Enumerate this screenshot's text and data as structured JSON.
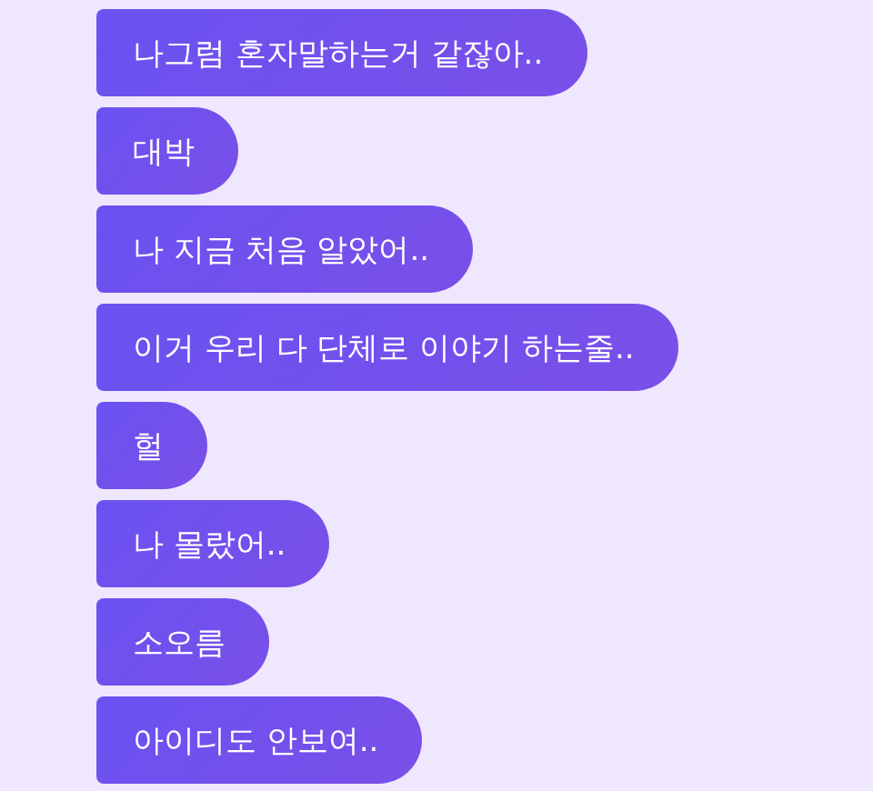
{
  "messages": [
    {
      "text": "나그럼 혼자말하는거 같잖아.."
    },
    {
      "text": "대박"
    },
    {
      "text": "나 지금 처음 알았어.."
    },
    {
      "text": "이거 우리 다 단체로 이야기 하는줄.."
    },
    {
      "text": "헐"
    },
    {
      "text": "나 몰랐어.."
    },
    {
      "text": "소오름"
    },
    {
      "text": "아이디도 안보여.."
    }
  ]
}
